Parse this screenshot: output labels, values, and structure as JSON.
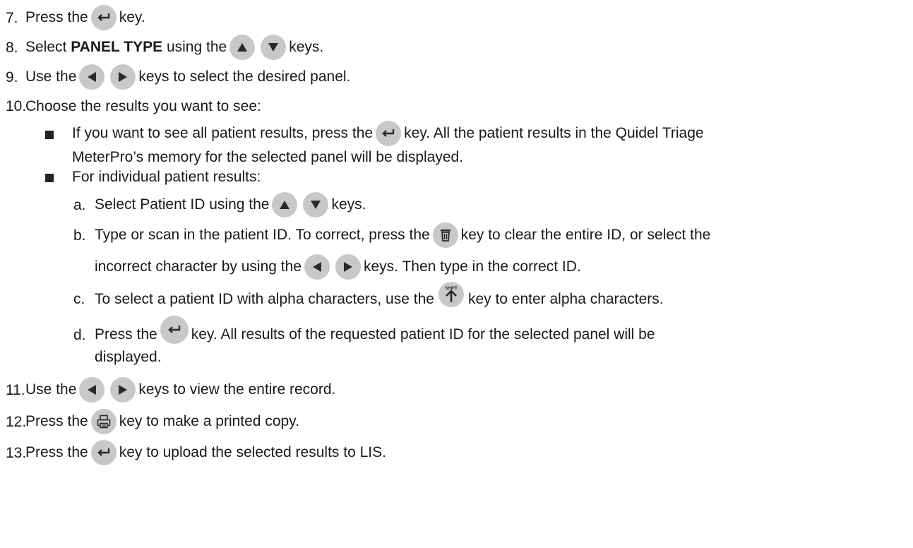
{
  "steps": {
    "s7": {
      "num": "7.",
      "a": "Press the",
      "b": "key."
    },
    "s8": {
      "num": "8.",
      "a": "Select ",
      "bold": "PANEL TYPE",
      "c": " using the",
      "d": "keys."
    },
    "s9": {
      "num": "9.",
      "a": "Use the",
      "b": "keys to select the desired panel."
    },
    "s10": {
      "num": "10.",
      "a": "Choose the results you want to see:"
    },
    "b1": {
      "a": "If you want to see all patient results, press the",
      "b": "key. All the patient results in the Quidel Triage",
      "c": "MeterPro’s memory for the selected panel will be displayed."
    },
    "b2": {
      "a": "For individual patient results:"
    },
    "sa": {
      "num": "a.",
      "a": "Select Patient ID using the",
      "b": "keys."
    },
    "sb": {
      "num": "b.",
      "a": "Type or scan in the patient ID. To correct, press the",
      "b": "key to clear the entire ID, or select the",
      "c": "incorrect character by using the",
      "d": "keys. Then type in the correct ID."
    },
    "sc": {
      "num": "c.",
      "a": "To select a patient ID with alpha characters, use the",
      "b": "key to enter alpha characters."
    },
    "sd": {
      "num": "d.",
      "a": "Press the",
      "b": "key. All results of the requested patient ID for the selected panel will be",
      "c": "displayed."
    },
    "s11": {
      "num": "11.",
      "a": "Use the",
      "b": "keys to view the entire record."
    },
    "s12": {
      "num": "12.",
      "a": "Press the",
      "b": "key to make a printed copy."
    },
    "s13": {
      "num": "13.",
      "a": "Press the",
      "b": "key to upload the selected results to LIS."
    }
  },
  "keys": {
    "enter": "enter-key-icon",
    "up": "up-arrow-key-icon",
    "down": "down-arrow-key-icon",
    "left": "left-arrow-key-icon",
    "right": "right-arrow-key-icon",
    "clear": "trash-key-icon",
    "shift": "shift-key-icon",
    "shift_label": "SHIFT",
    "print": "print-key-icon"
  },
  "colors": {
    "key_fill": "#c8c8c8",
    "key_glyph": "#2a2a2a",
    "text": "#1a1a1a"
  }
}
